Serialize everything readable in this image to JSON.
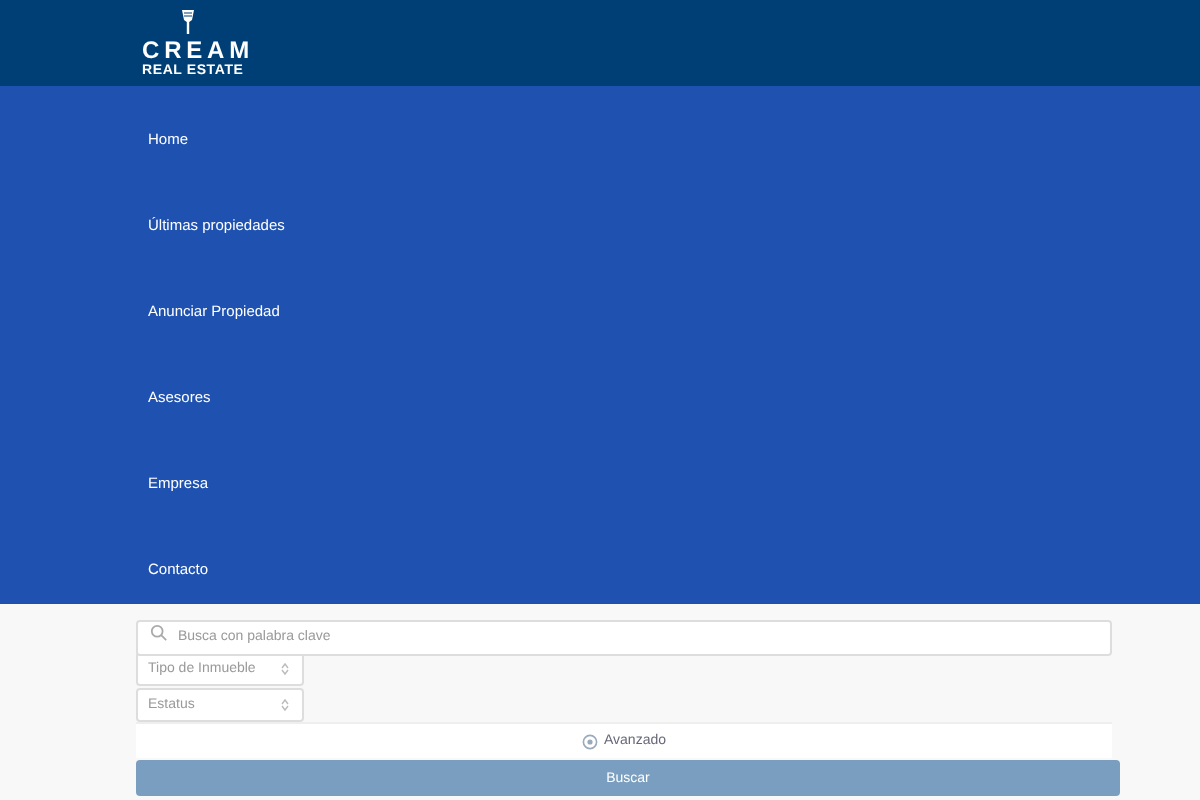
{
  "logo": {
    "title": "CREAM",
    "subtitle": "REAL ESTATE"
  },
  "nav": [
    {
      "label": "Home"
    },
    {
      "label": "Últimas propiedades"
    },
    {
      "label": "Anunciar Propiedad"
    },
    {
      "label": "Asesores"
    },
    {
      "label": "Empresa"
    },
    {
      "label": "Contacto"
    }
  ],
  "search": {
    "placeholder": "Busca con palabra clave"
  },
  "selects": [
    {
      "value": "Tipo de Inmueble"
    },
    {
      "value": "Estatus"
    }
  ],
  "advanced": "Avanzado",
  "submit": "Buscar"
}
